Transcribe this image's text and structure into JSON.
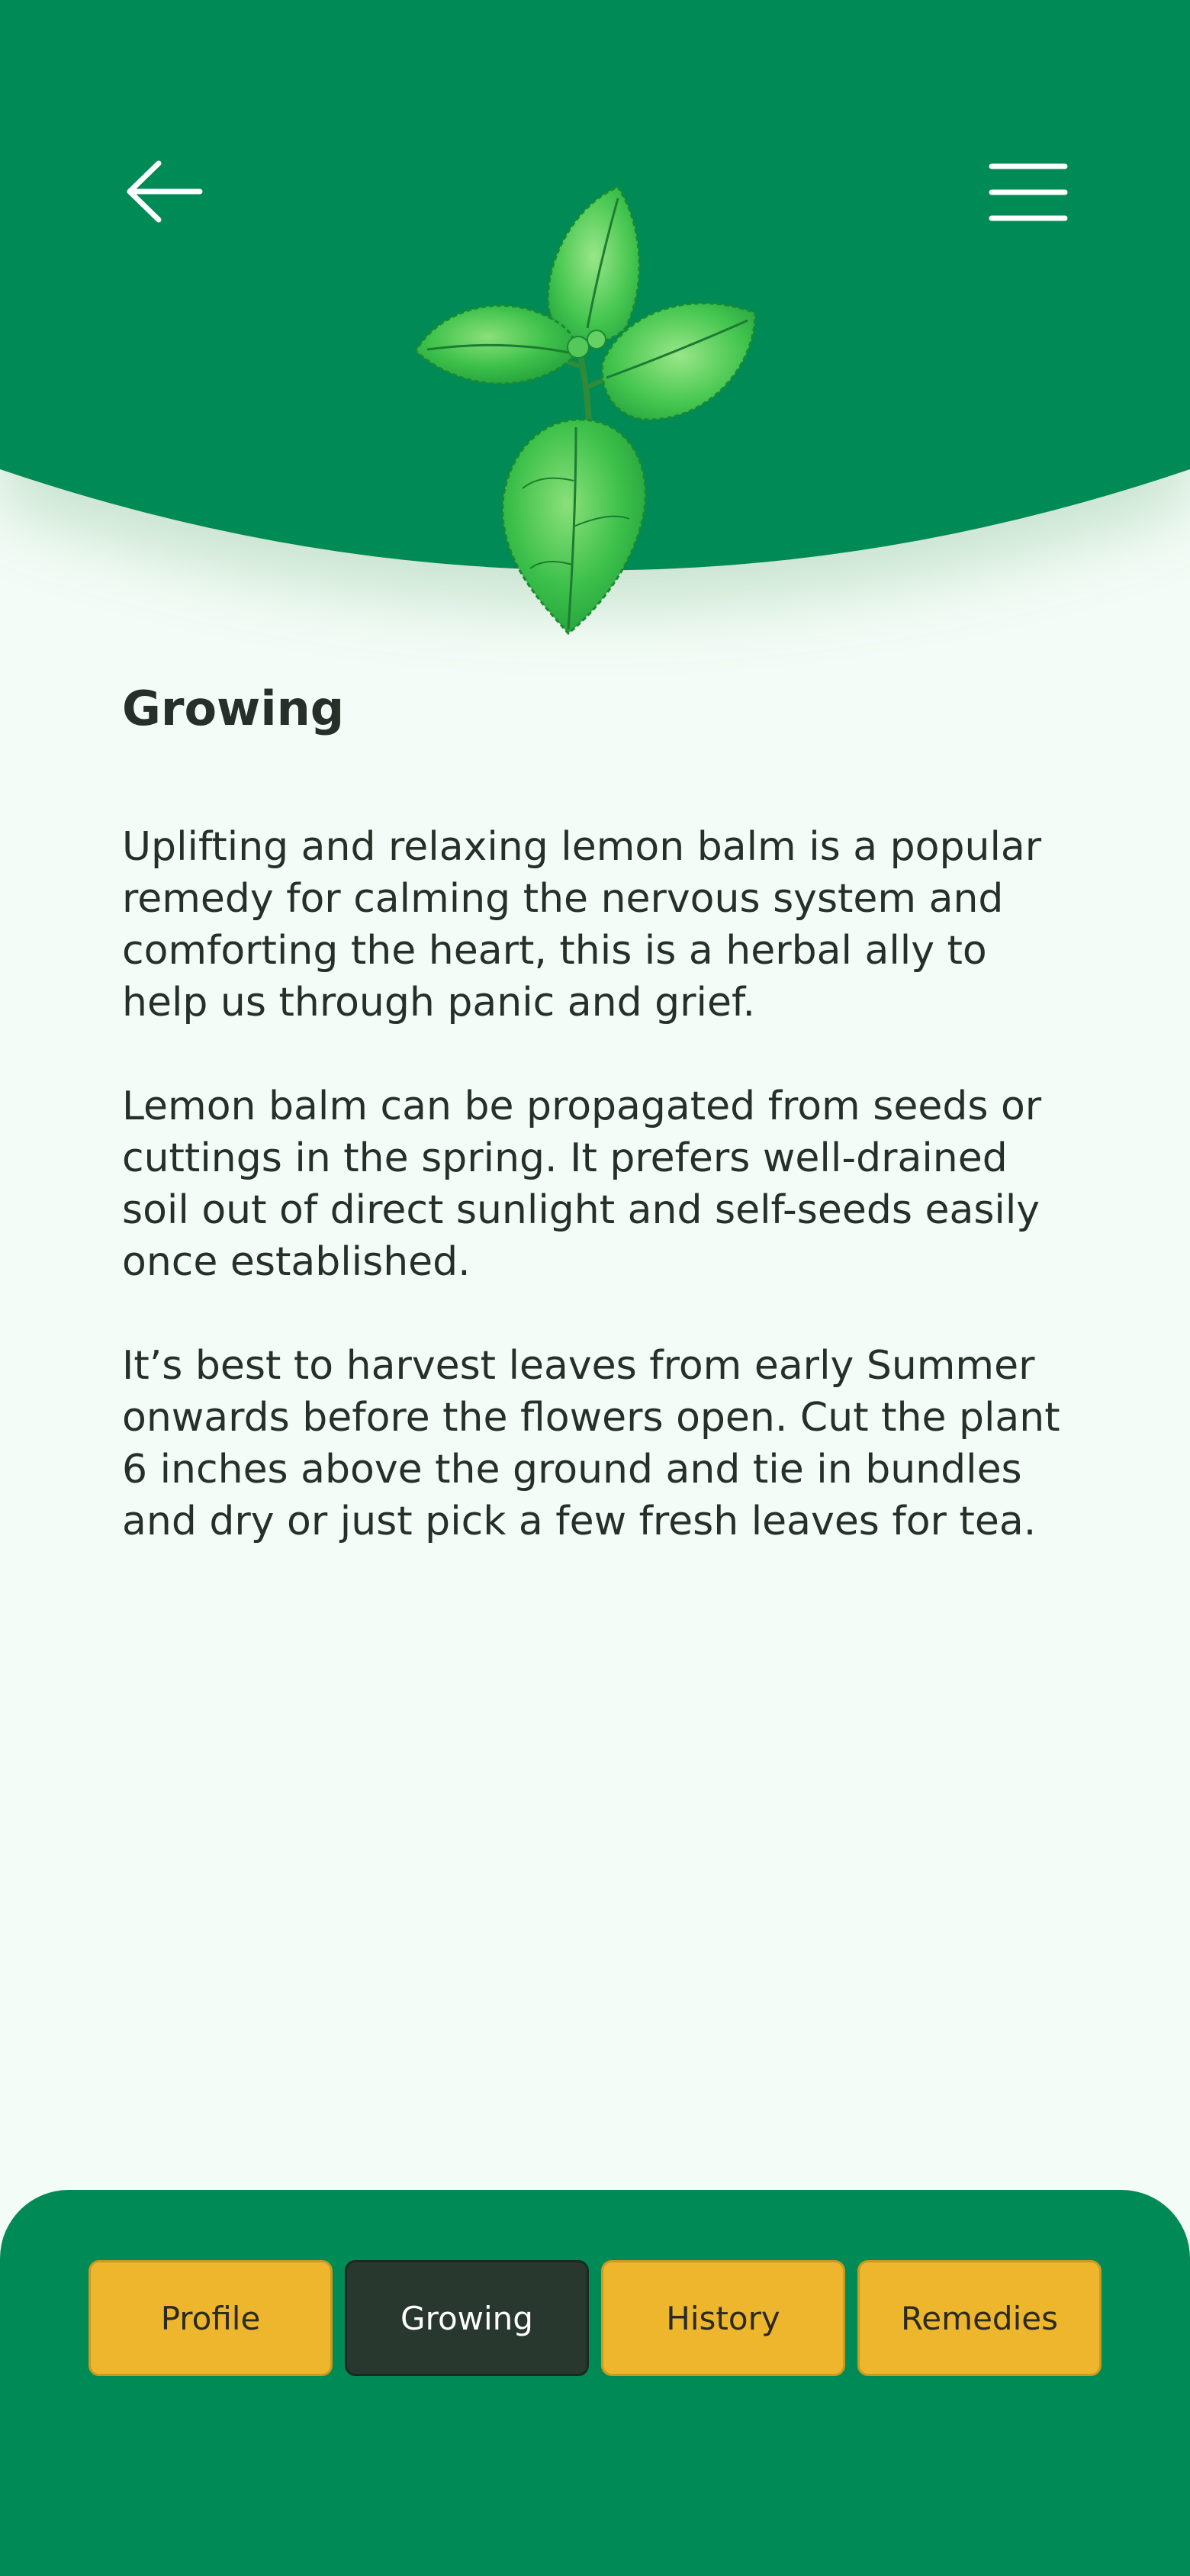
{
  "header": {
    "back_icon": "arrow-left-icon",
    "menu_icon": "hamburger-menu-icon",
    "plant": "lemon-balm-illustration",
    "color": "#008a55"
  },
  "content": {
    "title": "Growing",
    "paragraphs": [
      "Uplifting and relaxing lemon balm is a popular remedy for calming the nervous system and comforting the heart,  this is a herbal ally to help us through panic and grief.",
      "Lemon balm can be propagated from seeds or cuttings in the spring.  It prefers well-drained soil out of direct sunlight and self-seeds easily once established.",
      "It’s best to harvest leaves from early Summer onwards before the flowers open. Cut the plant 6 inches above the ground and tie in bundles and dry or just pick a few fresh leaves for tea."
    ]
  },
  "tabs": [
    {
      "label": "Profile",
      "active": false
    },
    {
      "label": "Growing",
      "active": true
    },
    {
      "label": "History",
      "active": false
    },
    {
      "label": "Remedies",
      "active": false
    }
  ],
  "colors": {
    "primary_green": "#008a55",
    "background": "#f3fcf6",
    "tab_yellow": "#edb62c",
    "tab_active": "#28382f",
    "text": "#243028"
  }
}
